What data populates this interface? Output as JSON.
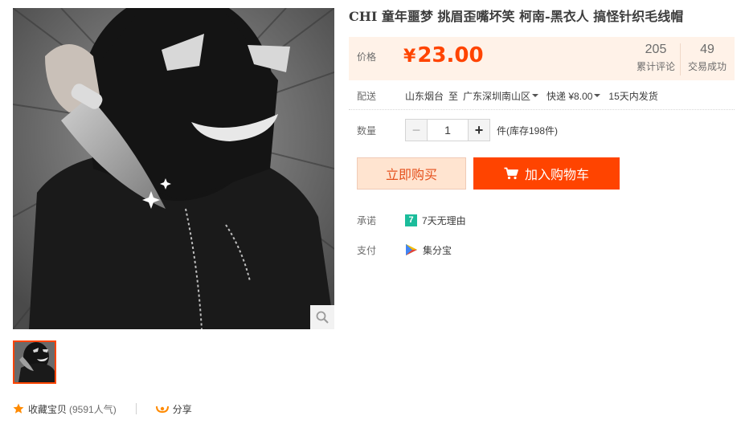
{
  "product": {
    "title": "CHI 童年噩梦 挑眉歪嘴坏笑 柯南-黑衣人 搞怪针织毛线帽"
  },
  "price": {
    "label": "价格",
    "currency": "¥",
    "amount": "23.00"
  },
  "stats": {
    "reviews_count": "205",
    "reviews_label": "累计评论",
    "deals_count": "49",
    "deals_label": "交易成功"
  },
  "shipping": {
    "label": "配送",
    "from": "山东烟台",
    "to_word": "至",
    "destination": "广东深圳南山区",
    "method": "快递 ¥8.00",
    "delivery_time": "15天内发货"
  },
  "quantity": {
    "label": "数量",
    "minus": "−",
    "value": "1",
    "plus": "+",
    "stock": "件(库存198件)"
  },
  "actions": {
    "buy_now": "立即购买",
    "add_to_cart": "加入购物车"
  },
  "promise": {
    "label": "承诺",
    "badge": "7",
    "text": "7天无理由"
  },
  "payment": {
    "label": "支付",
    "text": "集分宝"
  },
  "social": {
    "favorite": "收藏宝贝",
    "popularity": "(9591人气)",
    "share": "分享"
  },
  "colors": {
    "accent": "#ff4400",
    "price": "#ff4400",
    "price_bg": "#fff2e8",
    "buy_bg": "#ffe4d0",
    "promise_badge": "#1bbc9b"
  },
  "icons": [
    "zoom-icon",
    "cart-icon",
    "star-icon",
    "share-icon",
    "seven-day-badge-icon",
    "jifenbao-icon",
    "caret-down-icon"
  ]
}
